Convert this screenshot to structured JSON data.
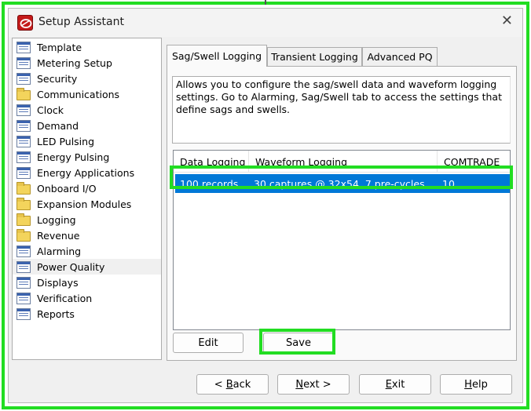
{
  "window": {
    "title": "Setup Assistant",
    "close_symbol": "✕",
    "app_icon": "setup-assistant-logo-icon",
    "accent_color": "#0078d7",
    "highlight_color": "#22dd22"
  },
  "nav": {
    "items": [
      {
        "label": "Template",
        "icon": "page"
      },
      {
        "label": "Metering Setup",
        "icon": "page"
      },
      {
        "label": "Security",
        "icon": "page"
      },
      {
        "label": "Communications",
        "icon": "folder"
      },
      {
        "label": "Clock",
        "icon": "page"
      },
      {
        "label": "Demand",
        "icon": "page"
      },
      {
        "label": "LED Pulsing",
        "icon": "page"
      },
      {
        "label": "Energy Pulsing",
        "icon": "page"
      },
      {
        "label": "Energy Applications",
        "icon": "page"
      },
      {
        "label": "Onboard I/O",
        "icon": "folder"
      },
      {
        "label": "Expansion Modules",
        "icon": "folder"
      },
      {
        "label": "Logging",
        "icon": "folder"
      },
      {
        "label": "Revenue",
        "icon": "folder"
      },
      {
        "label": "Alarming",
        "icon": "page"
      },
      {
        "label": "Power Quality",
        "icon": "page"
      },
      {
        "label": "Displays",
        "icon": "page"
      },
      {
        "label": "Verification",
        "icon": "page"
      },
      {
        "label": "Reports",
        "icon": "page"
      }
    ],
    "selected": "Power Quality"
  },
  "tabs": [
    {
      "label": "Sag/Swell Logging",
      "active": true
    },
    {
      "label": "Transient Logging",
      "active": false
    },
    {
      "label": "Advanced PQ",
      "active": false
    }
  ],
  "panel": {
    "description_lines": [
      "Allows you to configure the sag/swell data and waveform logging",
      "settings.  Go to Alarming, Sag/Swell tab to access the settings that",
      "define sags and swells."
    ],
    "table": {
      "columns": [
        "Data Logging",
        "Waveform Logging",
        "COMTRADE"
      ],
      "rows": [
        [
          "100 records",
          "30 captures @ 32x54, 7 pre-cycles",
          "10"
        ]
      ]
    },
    "edit_label": "Edit",
    "save_label": "Save"
  },
  "footer": {
    "back": {
      "mnemonic": "B",
      "rest": "ack",
      "prefix": "< "
    },
    "next": {
      "mnemonic": "N",
      "rest": "ext",
      "suffix": " >"
    },
    "exit": {
      "mnemonic": "E",
      "rest": "xit"
    },
    "help": {
      "mnemonic": "H",
      "rest": "elp"
    }
  }
}
